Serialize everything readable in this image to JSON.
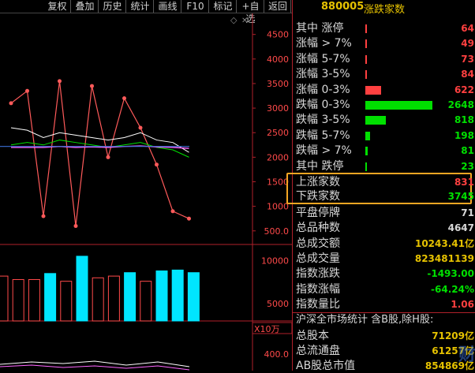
{
  "toolbar": {
    "items": [
      "复权",
      "叠加",
      "历史",
      "统计",
      "画线",
      "F10",
      "标记",
      "+自选",
      "返回"
    ]
  },
  "chart": {
    "price_ticks": [
      "4500",
      "4000",
      "3500",
      "3000",
      "2500",
      "2000",
      "1500",
      "1000",
      "500.0"
    ],
    "volume_ticks": [
      "10000",
      "5000"
    ],
    "volume_unit": "X10万",
    "lower_tick": "400.0"
  },
  "chart_data": {
    "type": "line",
    "series": [
      {
        "values": [
          3100,
          3350,
          800,
          3550,
          600,
          3450,
          2000,
          3200,
          2600,
          1850,
          900,
          750
        ]
      },
      {
        "values": [
          2600,
          2550,
          2400,
          2500,
          2450,
          2400,
          2350,
          2400,
          2500,
          2350,
          2300,
          2100
        ]
      },
      {
        "values": [
          2250,
          2300,
          2250,
          2350,
          2300,
          2250,
          2200,
          2250,
          2300,
          2200,
          2150,
          2000
        ]
      },
      {
        "values": [
          2200,
          2200,
          2200,
          2220,
          2200,
          2210,
          2200,
          2220,
          2230,
          2210,
          2200,
          2180
        ]
      }
    ],
    "volume": [
      8200,
      7800,
      7800,
      8500,
      7600,
      10500,
      8000,
      8200,
      8600,
      7600,
      8800,
      8900,
      8600
    ],
    "ylim_price": [
      400,
      4800
    ],
    "ylim_volume": [
      3000,
      11500
    ]
  },
  "panel": {
    "code": "880005",
    "name": "涨跌家数",
    "rows": [
      {
        "label": "其中 涨停",
        "value": "64",
        "bar": 0.008,
        "color": "#ff4040"
      },
      {
        "label": "涨幅 > 7%",
        "value": "49",
        "bar": 0.008,
        "color": "#ff4040"
      },
      {
        "label": "涨幅 5-7%",
        "value": "73",
        "bar": 0.01,
        "color": "#ff4040"
      },
      {
        "label": "涨幅 3-5%",
        "value": "84",
        "bar": 0.012,
        "color": "#ff4040"
      },
      {
        "label": "涨幅 0-3%",
        "value": "622",
        "bar": 0.23,
        "color": "#ff4040"
      },
      {
        "label": "跌幅 0-3%",
        "value": "2648",
        "bar": 1.0,
        "color": "#00e000"
      },
      {
        "label": "跌幅 3-5%",
        "value": "818",
        "bar": 0.31,
        "color": "#00e000"
      },
      {
        "label": "跌幅 5-7%",
        "value": "198",
        "bar": 0.075,
        "color": "#00e000"
      },
      {
        "label": "跌幅 > 7%",
        "value": "81",
        "bar": 0.03,
        "color": "#00e000"
      },
      {
        "label": "其中 跌停",
        "value": "23",
        "bar": 0.01,
        "color": "#00e000"
      }
    ],
    "up_label": "上涨家数",
    "up_value": "831",
    "down_label": "下跌家数",
    "down_value": "3745",
    "stats": [
      {
        "label": "平盘停牌",
        "value": "71",
        "color": "#d8d8d8"
      },
      {
        "label": "总品种数",
        "value": "4647",
        "color": "#d8d8d8"
      },
      {
        "label": "总成交额",
        "value": "10243.41亿",
        "color": "#e6c200"
      },
      {
        "label": "总成交量",
        "value": "823481139",
        "color": "#e6c200"
      },
      {
        "label": "指数涨跌",
        "value": "-1493.00",
        "color": "#00e000"
      },
      {
        "label": "指数涨幅",
        "value": "-64.24%",
        "color": "#00e000"
      },
      {
        "label": "指数量比",
        "value": "1.06",
        "color": "#ff4040"
      }
    ],
    "market_title": "沪深全市场统计 含B股,除H股:",
    "market": [
      {
        "label": "总股本",
        "value": "71209亿"
      },
      {
        "label": "总流通盘",
        "value": "61257亿"
      },
      {
        "label": "AB股总市值",
        "value": "854869亿"
      }
    ]
  }
}
